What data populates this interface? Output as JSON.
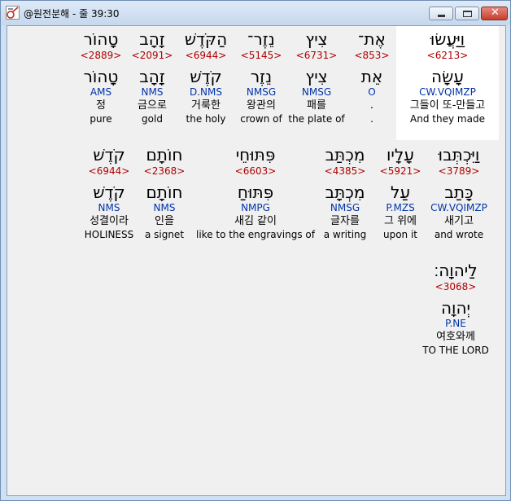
{
  "window": {
    "title": "@원전분해 - 줄 39:30",
    "buttons": {
      "minimize": "minimize-icon",
      "maximize": "maximize-icon",
      "close": "close-icon"
    }
  },
  "colors": {
    "strong": "#b00000",
    "morph": "#0033aa",
    "highlight": "#ffffff",
    "background": "#f0f0f0"
  },
  "words": [
    {
      "heb": "וַיַּעֲשׂוּ",
      "strong": "<6213>",
      "lemma": "עָשָׂה",
      "morph": "CW.VQIMZP",
      "kor": "그들이 또-만들고",
      "eng": "And they made"
    },
    {
      "heb": "אֶת־",
      "strong": "<853>",
      "lemma": "אֵת",
      "morph": "O",
      "kor": ".",
      "eng": "."
    },
    {
      "heb": "צִיץ",
      "strong": "<6731>",
      "lemma": "צִיץ",
      "morph": "NMSG",
      "kor": "패를",
      "eng": "the plate of"
    },
    {
      "heb": "נֵזֶר־",
      "strong": "<5145>",
      "lemma": "נֵזֶר",
      "morph": "NMSG",
      "kor": "왕관의",
      "eng": "crown of"
    },
    {
      "heb": "הַקֹּדֶשׁ",
      "strong": "<6944>",
      "lemma": "קֹדֶשׁ",
      "morph": "D.NMS",
      "kor": "거룩한",
      "eng": "the holy"
    },
    {
      "heb": "זָהָב",
      "strong": "<2091>",
      "lemma": "זָהָב",
      "morph": "NMS",
      "kor": "금으로",
      "eng": "gold"
    },
    {
      "heb": "טָהוֹר",
      "strong": "<2889>",
      "lemma": "טָהוֹר",
      "morph": "AMS",
      "kor": "정",
      "eng": "pure"
    },
    {
      "heb": "וַיִּכְתְּבוּ",
      "strong": "<3789>",
      "lemma": "כָּתַב",
      "morph": "CW.VQIMZP",
      "kor": "새기고",
      "eng": "and wrote"
    },
    {
      "heb": "עָלָיו",
      "strong": "<5921>",
      "lemma": "עַל",
      "morph": "P.MZS",
      "kor": "그 위에",
      "eng": "upon it"
    },
    {
      "heb": "מִכְתַּב",
      "strong": "<4385>",
      "lemma": "מִכְתָּב",
      "morph": "NMSG",
      "kor": "글자를",
      "eng": "a writing"
    },
    {
      "heb": "פִּתּוּחֵי",
      "strong": "<6603>",
      "lemma": "פִּתּוּחַ",
      "morph": "NMPG",
      "kor": "새김 같이",
      "eng": "like to the engravings of"
    },
    {
      "heb": "חוֹתָם",
      "strong": "<2368>",
      "lemma": "חוֹתָם",
      "morph": "NMS",
      "kor": "인을",
      "eng": "a signet"
    },
    {
      "heb": "קֹדֶשׁ",
      "strong": "<6944>",
      "lemma": "קֹדֶשׁ",
      "morph": "NMS",
      "kor": "성결이라",
      "eng": "HOLINESS"
    },
    {
      "heb": "לַיהוָה׃",
      "strong": "<3068>",
      "lemma": "יְהוָה",
      "morph": "P.NE",
      "kor": "여호와께",
      "eng": "TO THE  LORD"
    }
  ]
}
